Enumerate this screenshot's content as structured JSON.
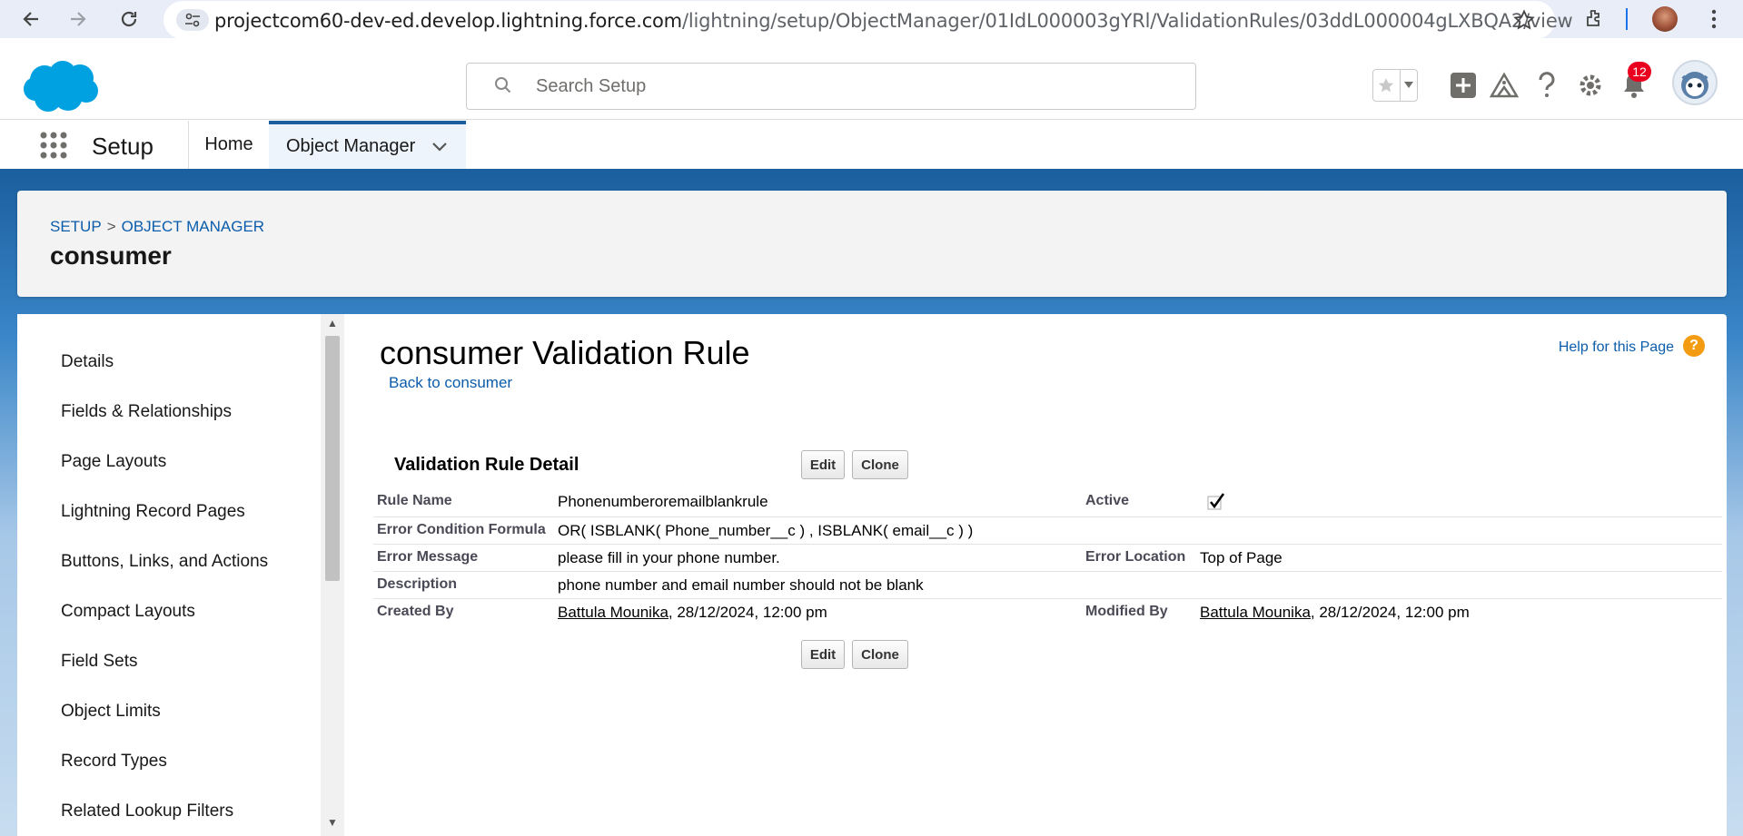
{
  "browser": {
    "url_host": "projectcom60-dev-ed.develop.lightning.force.com",
    "url_path": "/lightning/setup/ObjectManager/01IdL000003gYRl/ValidationRules/03ddL000004gLXBQA2/view"
  },
  "header": {
    "search_placeholder": "Search Setup",
    "notification_count": "12"
  },
  "setup_nav": {
    "app_name": "Setup",
    "tabs": [
      {
        "label": "Home"
      },
      {
        "label": "Object Manager"
      }
    ]
  },
  "page_header": {
    "breadcrumb": [
      "SETUP",
      "OBJECT MANAGER"
    ],
    "breadcrumb_sep": ">",
    "title": "consumer"
  },
  "sidebar": {
    "items": [
      {
        "label": "Details"
      },
      {
        "label": "Fields & Relationships"
      },
      {
        "label": "Page Layouts"
      },
      {
        "label": "Lightning Record Pages"
      },
      {
        "label": "Buttons, Links, and Actions"
      },
      {
        "label": "Compact Layouts"
      },
      {
        "label": "Field Sets"
      },
      {
        "label": "Object Limits"
      },
      {
        "label": "Record Types"
      },
      {
        "label": "Related Lookup Filters"
      }
    ]
  },
  "content": {
    "title": "consumer Validation Rule",
    "back_link": "Back to consumer",
    "help_link": "Help for this Page",
    "section_title": "Validation Rule Detail",
    "edit_label": "Edit",
    "clone_label": "Clone",
    "fields": {
      "rule_name_label": "Rule Name",
      "rule_name_value": "Phonenumberoremailblankrule",
      "active_label": "Active",
      "active_value": true,
      "formula_label": "Error Condition Formula",
      "formula_value": "OR( ISBLANK( Phone_number__c ) , ISBLANK( email__c ) )",
      "error_message_label": "Error Message",
      "error_message_value": "please fill in your phone number.",
      "error_location_label": "Error Location",
      "error_location_value": "Top of Page",
      "description_label": "Description",
      "description_value": "phone number and email number should not be blank",
      "created_by_label": "Created By",
      "created_by_user": "Battula Mounika",
      "created_by_date": ", 28/12/2024, 12:00 pm",
      "modified_by_label": "Modified By",
      "modified_by_user": "Battula Mounika",
      "modified_by_date": ", 28/12/2024, 12:00 pm"
    }
  },
  "colors": {
    "brand_blue": "#1b5f9e",
    "link": "#0b5cab",
    "salesforce_cloud": "#00a1e0",
    "badge_red": "#ea001e"
  }
}
